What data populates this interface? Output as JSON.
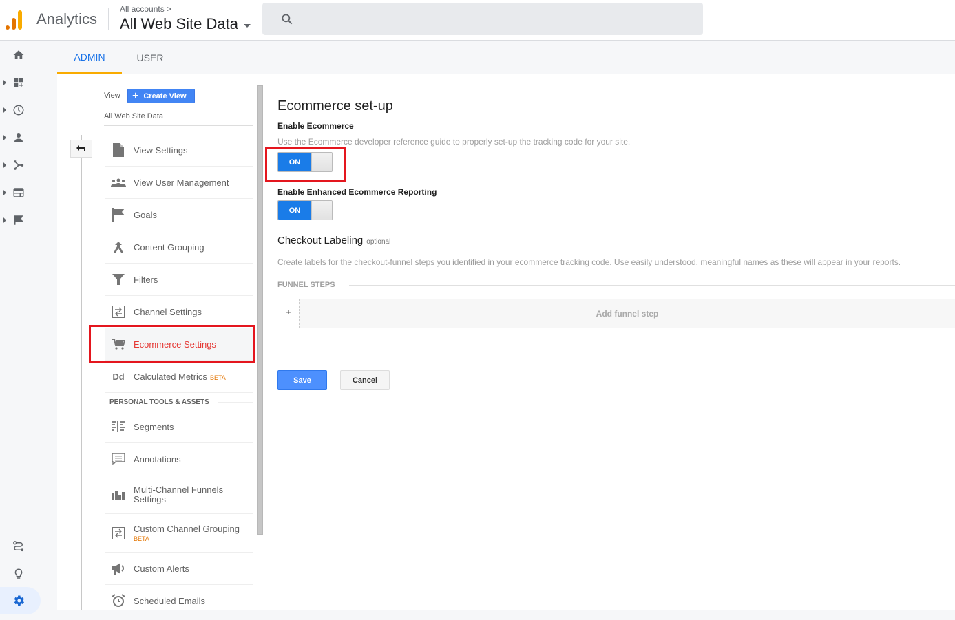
{
  "header": {
    "app_name": "Analytics",
    "account_breadcrumb": "All accounts >",
    "property_name": "All Web Site Data"
  },
  "left_nav": {
    "items": [
      {
        "icon": "home-icon"
      },
      {
        "icon": "customization-icon"
      },
      {
        "icon": "realtime-clock-icon"
      },
      {
        "icon": "audience-person-icon"
      },
      {
        "icon": "acquisition-icon"
      },
      {
        "icon": "behavior-icon"
      },
      {
        "icon": "conversions-flag-icon"
      }
    ],
    "bottom_items": [
      {
        "icon": "attribution-icon"
      },
      {
        "icon": "discover-bulb-icon"
      },
      {
        "icon": "admin-gear-icon"
      }
    ]
  },
  "tabs": [
    {
      "label": "ADMIN",
      "active": true
    },
    {
      "label": "USER",
      "active": false
    }
  ],
  "view_column": {
    "view_label": "View",
    "create_view_label": "Create View",
    "view_name": "All Web Site Data",
    "menu": [
      {
        "label": "View Settings",
        "icon": "document-icon"
      },
      {
        "label": "View User Management",
        "icon": "people-icon"
      },
      {
        "label": "Goals",
        "icon": "flag-icon"
      },
      {
        "label": "Content Grouping",
        "icon": "content-grouping-icon"
      },
      {
        "label": "Filters",
        "icon": "filter-icon"
      },
      {
        "label": "Channel Settings",
        "icon": "channel-icon"
      },
      {
        "label": "Ecommerce Settings",
        "icon": "cart-icon",
        "active": true
      },
      {
        "label": "Calculated Metrics",
        "icon": "dd-icon",
        "badge": "BETA"
      }
    ],
    "section_title": "PERSONAL TOOLS & ASSETS",
    "personal_menu": [
      {
        "label": "Segments",
        "icon": "segments-icon"
      },
      {
        "label": "Annotations",
        "icon": "annotation-icon"
      },
      {
        "label": "Multi-Channel Funnels Settings",
        "icon": "bar-chart-icon"
      },
      {
        "label": "Custom Channel Grouping",
        "icon": "channel-icon",
        "badge": "BETA"
      },
      {
        "label": "Custom Alerts",
        "icon": "megaphone-icon"
      },
      {
        "label": "Scheduled Emails",
        "icon": "alarm-clock-icon"
      }
    ]
  },
  "main": {
    "title": "Ecommerce set-up",
    "enable_ecommerce": {
      "label": "Enable Ecommerce",
      "description": "Use the Ecommerce developer reference guide to properly set-up the tracking code for your site.",
      "toggle_label": "ON",
      "state": "on"
    },
    "enable_enhanced": {
      "label": "Enable Enhanced Ecommerce Reporting",
      "toggle_label": "ON",
      "state": "on"
    },
    "checkout": {
      "title": "Checkout Labeling",
      "optional": "optional",
      "description": "Create labels for the checkout-funnel steps you identified in your ecommerce tracking code. Use easily understood, meaningful names as these will appear in your reports.",
      "funnel_steps_label": "FUNNEL STEPS",
      "add_step_plus": "+",
      "add_step_label": "Add funnel step"
    },
    "save_label": "Save",
    "cancel_label": "Cancel"
  },
  "colors": {
    "accent_blue": "#1a73e8",
    "tab_underline": "#f9ab00",
    "highlight_red": "#e4161e",
    "toggle_on": "#1a7ce8",
    "beta_orange": "#e37400"
  }
}
